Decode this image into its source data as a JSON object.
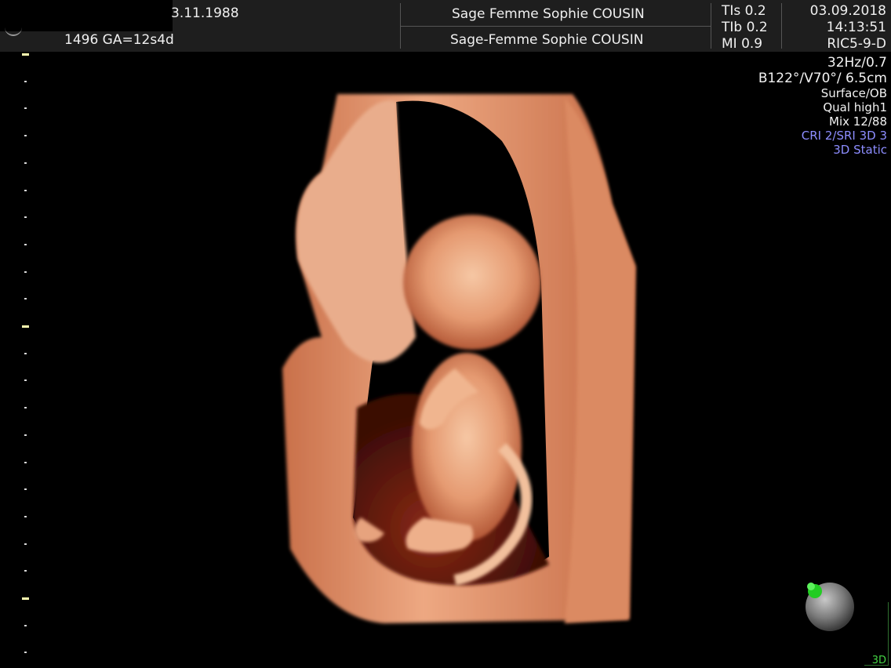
{
  "header": {
    "dob_fragment": "3.11.1988",
    "patient_line": "1496  GA=12s4d",
    "operator_line1": "Sage Femme Sophie COUSIN",
    "operator_line2": "Sage-Femme Sophie COUSIN",
    "tis": "TIs  0.2",
    "tib": "TIb  0.2",
    "mi": "MI  0.9",
    "date": "03.09.2018",
    "time": "14:13:51",
    "probe": "RIC5-9-D"
  },
  "params": {
    "frame_rate": "32Hz/0.7",
    "geometry": "B122°/V70°/ 6.5cm",
    "mode": "Surface/OB",
    "quality": "Qual high1",
    "mix": "Mix 12/88",
    "cri": "CRI 2/SRI 3D 3",
    "acquisition": "3D Static"
  },
  "footer": {
    "mode_badge": "3D"
  },
  "colors": {
    "header_bg": "#1e1e1e",
    "accent_blue": "#8d8dff",
    "scale_major": "#ffffb0",
    "render_skin": "#e9a57f",
    "render_shadow": "#7a2614",
    "orientation_green": "#22cc22"
  },
  "icons": {
    "logo": "arc-logo-icon",
    "orientation": "orientation-sphere-icon"
  }
}
